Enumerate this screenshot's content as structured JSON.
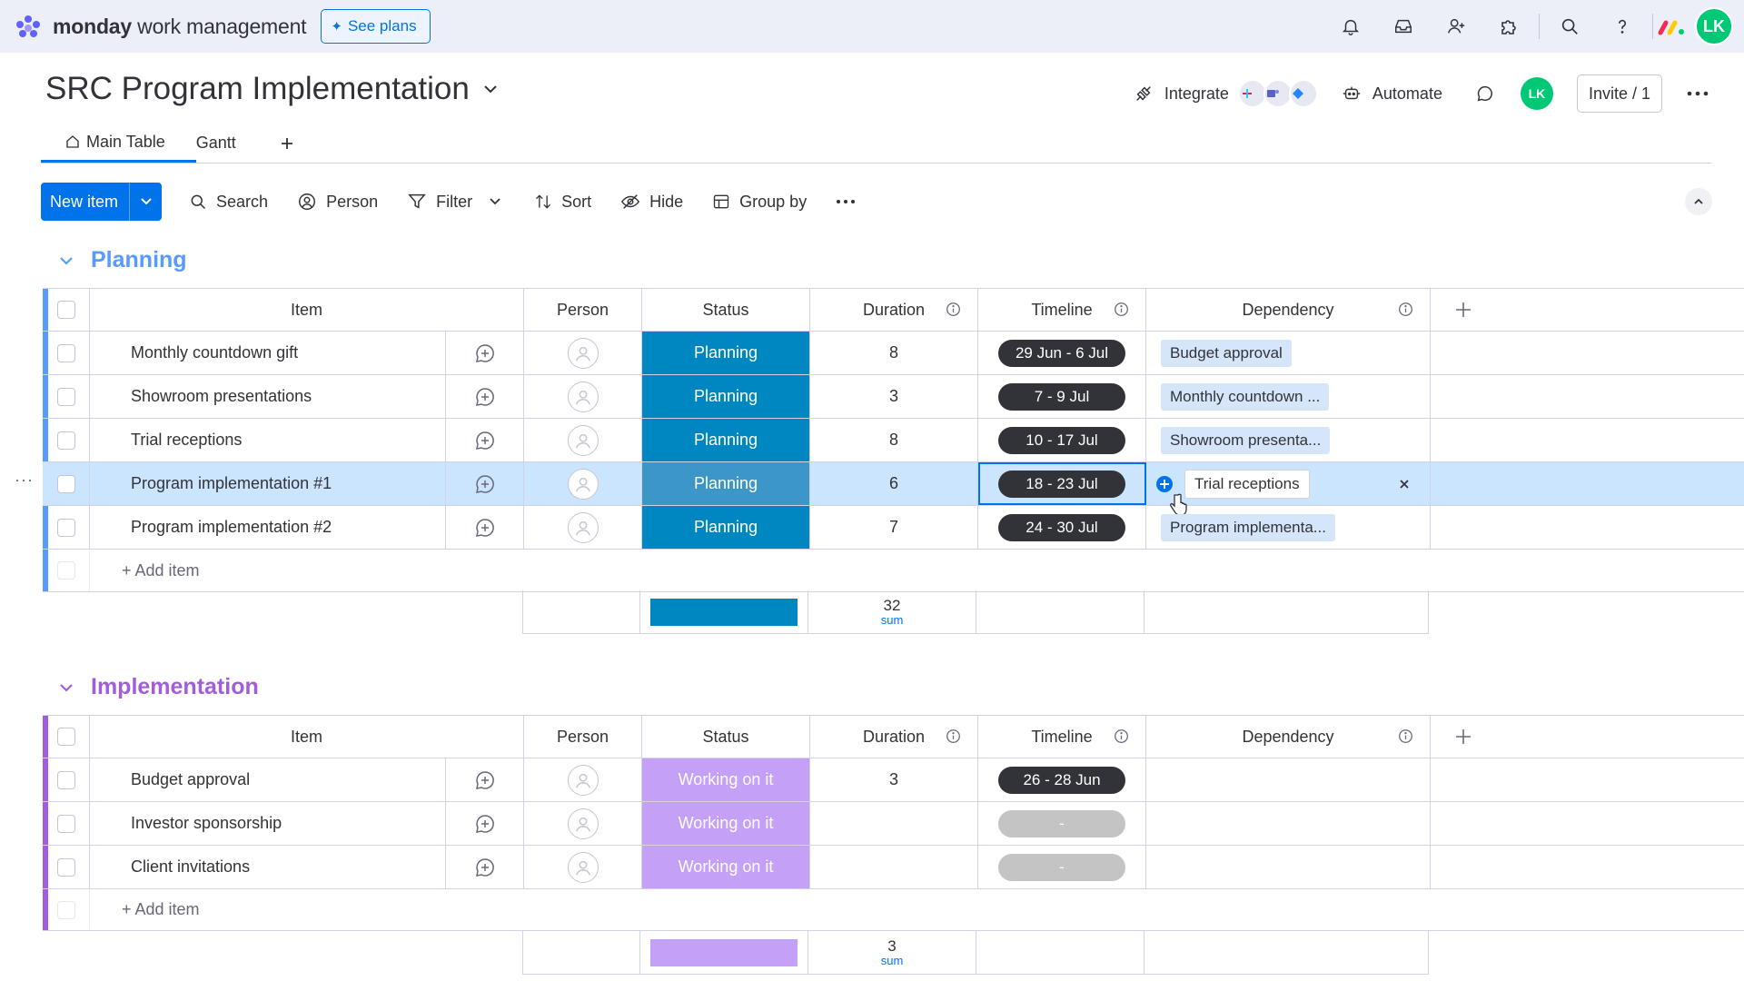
{
  "app": {
    "brand_bold": "monday",
    "brand_rest": " work management",
    "see_plans": "See plans",
    "user_initials": "LK"
  },
  "board": {
    "title": "SRC Program Implementation",
    "integrate": "Integrate",
    "automate": "Automate",
    "invite": "Invite / 1",
    "avatar": "LK"
  },
  "tabs": [
    {
      "label": "Main Table",
      "active": true
    },
    {
      "label": "Gantt",
      "active": false
    }
  ],
  "toolbar": {
    "new_item": "New item",
    "search": "Search",
    "person": "Person",
    "filter": "Filter",
    "sort": "Sort",
    "hide": "Hide",
    "group_by": "Group by"
  },
  "columns": {
    "item": "Item",
    "person": "Person",
    "status": "Status",
    "duration": "Duration",
    "timeline": "Timeline",
    "dependency": "Dependency"
  },
  "colors": {
    "planning_group": "#579bfc",
    "planning_status": "#0086c0",
    "implementation_group": "#a25ddc",
    "working_status": "#c4a0f7",
    "selection": "#cce5ff"
  },
  "groups": [
    {
      "title": "Planning",
      "rows": [
        {
          "item": "Monthly countdown gift",
          "status": "Planning",
          "duration": "8",
          "timeline": "29 Jun - 6 Jul",
          "dependency": "Budget approval"
        },
        {
          "item": "Showroom presentations",
          "status": "Planning",
          "duration": "3",
          "timeline": "7 - 9 Jul",
          "dependency": "Monthly countdown ..."
        },
        {
          "item": "Trial receptions",
          "status": "Planning",
          "duration": "8",
          "timeline": "10 - 17 Jul",
          "dependency": "Showroom presenta..."
        },
        {
          "item": "Program implementation #1",
          "status": "Planning",
          "duration": "6",
          "timeline": "18 - 23 Jul",
          "dependency": "Trial receptions"
        },
        {
          "item": "Program implementation #2",
          "status": "Planning",
          "duration": "7",
          "timeline": "24 - 30 Jul",
          "dependency": "Program implementa..."
        }
      ],
      "add_item": "+ Add item",
      "sum_value": "32",
      "sum_label": "sum"
    },
    {
      "title": "Implementation",
      "rows": [
        {
          "item": "Budget approval",
          "status": "Working on it",
          "duration": "3",
          "timeline": "26 - 28 Jun",
          "dependency": ""
        },
        {
          "item": "Investor sponsorship",
          "status": "Working on it",
          "duration": "",
          "timeline": "-",
          "dependency": ""
        },
        {
          "item": "Client invitations",
          "status": "Working on it",
          "duration": "",
          "timeline": "-",
          "dependency": ""
        }
      ],
      "add_item": "+ Add item",
      "sum_value": "3",
      "sum_label": "sum"
    }
  ],
  "row_menu": "···"
}
